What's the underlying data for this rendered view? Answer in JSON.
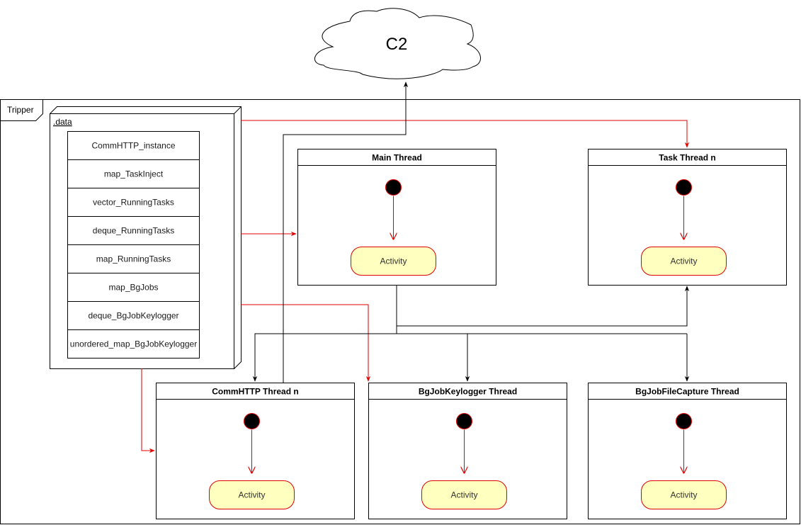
{
  "cloud": {
    "label": "C2"
  },
  "frame": {
    "label": "Tripper"
  },
  "data_node": {
    "label": ".data",
    "rows": [
      "CommHTTP_instance",
      "map_TaskInject",
      "vector_RunningTasks",
      "deque_RunningTasks",
      "map_RunningTasks",
      "map_BgJobs",
      "deque_BgJobKeylogger",
      "unordered_map_BgJobKeylogger"
    ]
  },
  "threads": [
    {
      "id": "main",
      "title": "Main Thread",
      "activity": "Activity"
    },
    {
      "id": "task",
      "title": "Task Thread n",
      "activity": "Activity"
    },
    {
      "id": "commhttp",
      "title": "CommHTTP Thread n",
      "activity": "Activity"
    },
    {
      "id": "keylogger",
      "title": "BgJobKeylogger Thread",
      "activity": "Activity"
    },
    {
      "id": "filecapture",
      "title": "BgJobFileCapture Thread",
      "activity": "Activity"
    }
  ],
  "colors": {
    "data_flow": "#e00000",
    "control_flow": "#000000",
    "activity_fill": "#ffffc0",
    "activity_stroke": "#e00000",
    "initial_node_fill": "#000000"
  }
}
